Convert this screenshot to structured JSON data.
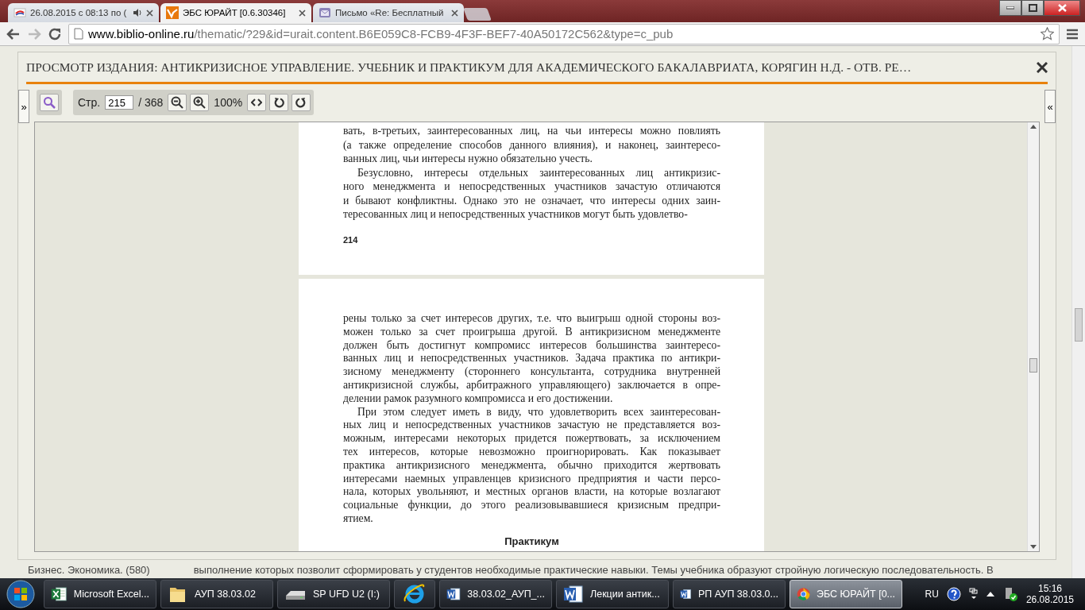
{
  "browser": {
    "tabs": [
      {
        "title": "26.08.2015 с 08:13 по (",
        "kind": "site",
        "audio": true,
        "selected": false
      },
      {
        "title": "ЭБС ЮРАЙТ [0.6.30346]",
        "kind": "urait",
        "audio": false,
        "selected": true
      },
      {
        "title": "Письмо «Re: Бесплатный",
        "kind": "mail",
        "audio": false,
        "selected": false
      }
    ],
    "url_host": "www.biblio-online.ru",
    "url_path": "/thematic/?29&id=urait.content.B6E059C8-FCB9-4F3F-BEF7-40A50172C562&type=c_pub"
  },
  "viewer": {
    "title": "ПРОСМОТР ИЗДАНИЯ: АНТИКРИЗИСНОЕ УПРАВЛЕНИЕ. УЧЕБНИК И ПРАКТИКУМ ДЛЯ АКАДЕМИЧЕСКОГО БАКАЛАВРИАТА, КОРЯГИН Н.Д. - ОТВ. РЕ…",
    "expand_left": "»",
    "expand_right": "«",
    "page_label": "Стр.",
    "page_value": "215",
    "page_total": "/ 368",
    "zoom": "100%",
    "pages": [
      {
        "paragraphs": [
          {
            "indent": false,
            "lines": [
              "вать, в-третьих, заинтересованных лиц, на чьи интересы можно повлиять",
              "(а также определение способов данного влияния), и наконец, заинтересо-",
              "ванных лиц, чьи интересы нужно обязательно учесть."
            ]
          },
          {
            "indent": true,
            "lines": [
              "Безусловно, интересы отдельных заинтересованных лиц антикризис-",
              "ного менеджмента и непосредственных участников зачастую отличаются",
              "и бывают конфликтны. Однако это не означает, что интересы одних заин-",
              "тересованных лиц и непосредственных участников могут быть удовлетво-"
            ]
          }
        ],
        "number": "214"
      },
      {
        "paragraphs": [
          {
            "indent": false,
            "lines": [
              "рены только за счет интересов других, т.е. что выигрыш одной стороны воз-",
              "можен только за счет проигрыша другой. В антикризисном менеджменте",
              "должен быть достигнут компромисс интересов большинства заинтересо-",
              "ванных лиц и непосредственных участников. Задача практика по антикри-",
              "зисному менеджменту (стороннего консультанта, сотрудника внутренней",
              "антикризисной службы, арбитражного управляющего) заключается в опре-",
              "делении рамок разумного компромисса и его достижении."
            ]
          },
          {
            "indent": true,
            "lines": [
              "При этом следует иметь в виду, что удовлетворить всех заинтересован-",
              "ных лиц и непосредственных участников зачастую не представляется воз-",
              "можным, интересами некоторых придется пожертвовать, за исключением",
              "тех интересов, которые невозможно проигнорировать. Как показывает",
              "практика антикризисного менеджмента, обычно приходится жертвовать",
              "интересами наемных управленцев кризисного предприятия и части персо-",
              "нала, которых увольняют, и местных органов власти, на которые возлагают",
              "социальные функции, до этого реализовывавшиеся кризисным предпри-",
              "ятием."
            ]
          }
        ],
        "heading": "Практикум"
      }
    ]
  },
  "background_page": {
    "category": "Бизнес. Экономика. (580)",
    "description": "выполнение которых позволит сформировать у студентов необходимые практические навыки. Темы учебника образуют стройную логическую последовательность. В"
  },
  "taskbar": {
    "buttons": [
      {
        "kind": "excel",
        "label": "Microsoft Excel...",
        "selected": false
      },
      {
        "kind": "folder",
        "label": "АУП 38.03.02",
        "selected": false
      },
      {
        "kind": "drive",
        "label": "SP UFD U2 (I:)",
        "selected": false
      },
      {
        "kind": "ie",
        "selected": false
      },
      {
        "kind": "word",
        "label": "38.03.02_АУП_...",
        "selected": false
      },
      {
        "kind": "word",
        "label": "Лекции антик...",
        "selected": false
      },
      {
        "kind": "word",
        "label": "РП АУП 38.03.0...",
        "selected": false
      },
      {
        "kind": "chrome",
        "label": "ЭБС ЮРАЙТ [0...",
        "selected": true
      }
    ],
    "language": "RU",
    "time": "15:16",
    "date": "26.08.2015"
  }
}
